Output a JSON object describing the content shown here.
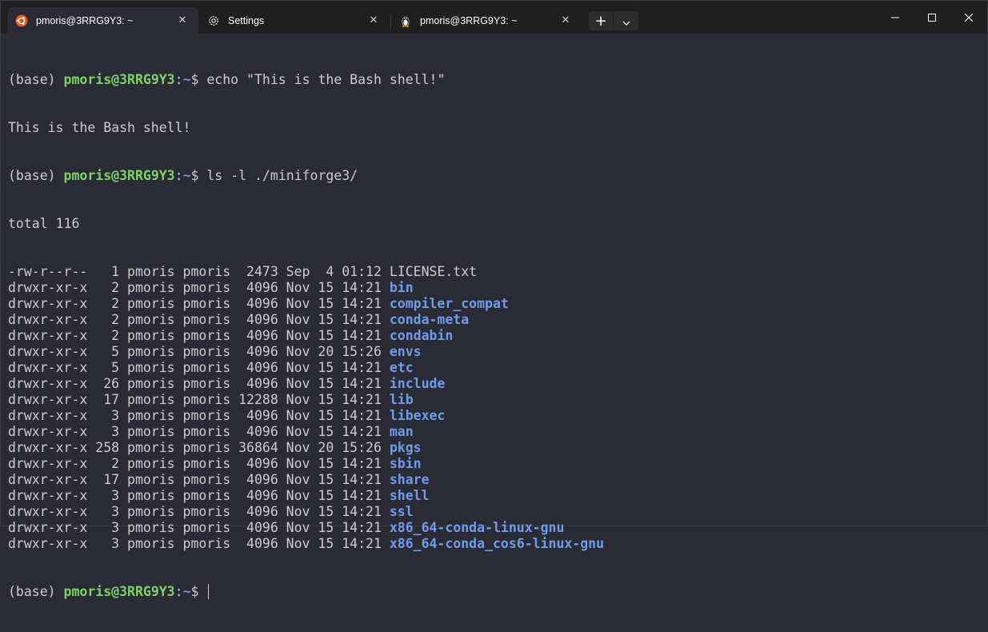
{
  "tabs": [
    {
      "label": "pmoris@3RRG9Y3: ~",
      "icon": "ubuntu-icon",
      "active": true
    },
    {
      "label": "Settings",
      "icon": "gear-icon",
      "active": false
    },
    {
      "label": "pmoris@3RRG9Y3: ~",
      "icon": "linux-penguin-icon",
      "active": false
    }
  ],
  "tab_close_glyph": "✕",
  "new_tab_glyph": "+",
  "colors": {
    "background": "#2b2b36",
    "titlebar": "#1f1f1f",
    "prompt_user": "#7fd16a",
    "path_and_dirs": "#6e9ce8",
    "text": "#cccccc",
    "ubuntu_orange": "#e95420"
  },
  "terminal": {
    "prompt_prefix": "(base) ",
    "prompt_user": "pmoris@3RRG9Y3",
    "prompt_colon": ":",
    "prompt_path": "~",
    "prompt_suffix": "$ ",
    "cmd1": "echo \"This is the Bash shell!\"",
    "out1": "This is the Bash shell!",
    "cmd2": "ls -l ./miniforge3/",
    "total": "total 116",
    "listing": [
      {
        "meta": "-rw-r--r--   1 pmoris pmoris  2473 Sep  4 01:12 ",
        "name": "LICENSE.txt",
        "is_dir": false
      },
      {
        "meta": "drwxr-xr-x   2 pmoris pmoris  4096 Nov 15 14:21 ",
        "name": "bin",
        "is_dir": true
      },
      {
        "meta": "drwxr-xr-x   2 pmoris pmoris  4096 Nov 15 14:21 ",
        "name": "compiler_compat",
        "is_dir": true
      },
      {
        "meta": "drwxr-xr-x   2 pmoris pmoris  4096 Nov 15 14:21 ",
        "name": "conda-meta",
        "is_dir": true
      },
      {
        "meta": "drwxr-xr-x   2 pmoris pmoris  4096 Nov 15 14:21 ",
        "name": "condabin",
        "is_dir": true
      },
      {
        "meta": "drwxr-xr-x   5 pmoris pmoris  4096 Nov 20 15:26 ",
        "name": "envs",
        "is_dir": true
      },
      {
        "meta": "drwxr-xr-x   5 pmoris pmoris  4096 Nov 15 14:21 ",
        "name": "etc",
        "is_dir": true
      },
      {
        "meta": "drwxr-xr-x  26 pmoris pmoris  4096 Nov 15 14:21 ",
        "name": "include",
        "is_dir": true
      },
      {
        "meta": "drwxr-xr-x  17 pmoris pmoris 12288 Nov 15 14:21 ",
        "name": "lib",
        "is_dir": true
      },
      {
        "meta": "drwxr-xr-x   3 pmoris pmoris  4096 Nov 15 14:21 ",
        "name": "libexec",
        "is_dir": true
      },
      {
        "meta": "drwxr-xr-x   3 pmoris pmoris  4096 Nov 15 14:21 ",
        "name": "man",
        "is_dir": true
      },
      {
        "meta": "drwxr-xr-x 258 pmoris pmoris 36864 Nov 20 15:26 ",
        "name": "pkgs",
        "is_dir": true
      },
      {
        "meta": "drwxr-xr-x   2 pmoris pmoris  4096 Nov 15 14:21 ",
        "name": "sbin",
        "is_dir": true
      },
      {
        "meta": "drwxr-xr-x  17 pmoris pmoris  4096 Nov 15 14:21 ",
        "name": "share",
        "is_dir": true
      },
      {
        "meta": "drwxr-xr-x   3 pmoris pmoris  4096 Nov 15 14:21 ",
        "name": "shell",
        "is_dir": true
      },
      {
        "meta": "drwxr-xr-x   3 pmoris pmoris  4096 Nov 15 14:21 ",
        "name": "ssl",
        "is_dir": true
      },
      {
        "meta": "drwxr-xr-x   3 pmoris pmoris  4096 Nov 15 14:21 ",
        "name": "x86_64-conda-linux-gnu",
        "is_dir": true
      },
      {
        "meta": "drwxr-xr-x   3 pmoris pmoris  4096 Nov 15 14:21 ",
        "name": "x86_64-conda_cos6-linux-gnu",
        "is_dir": true
      }
    ]
  }
}
